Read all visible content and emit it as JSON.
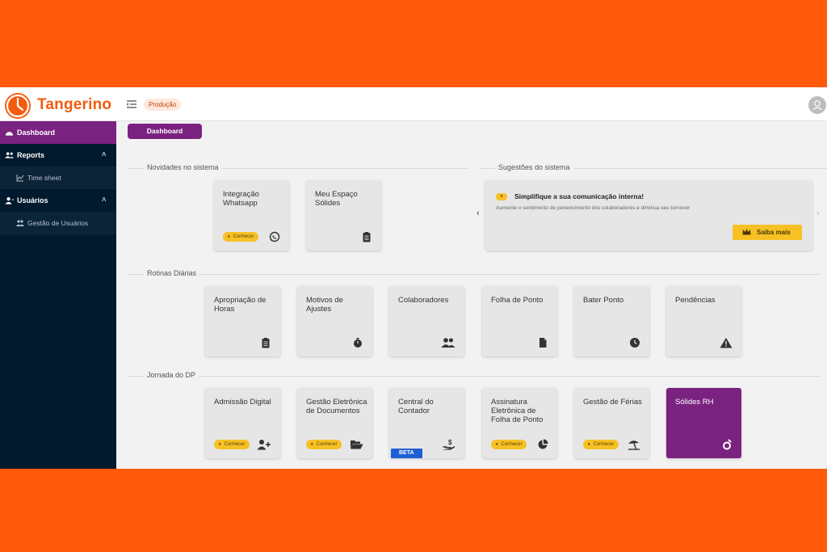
{
  "app": {
    "brand": "Tangerino",
    "environment": "Produção",
    "accent_color": "#7a2280",
    "brand_color": "#f35b0d"
  },
  "sidebar": {
    "items": [
      {
        "label": "Dashboard",
        "icon": "dashboard-icon",
        "active": true
      },
      {
        "label": "Reports",
        "icon": "users-icon",
        "expanded": true,
        "chevron": "˄"
      },
      {
        "label": "Time sheet",
        "icon": "chart-icon",
        "sub": true
      },
      {
        "label": "Usuários",
        "icon": "user-icon",
        "expanded": true,
        "chevron": "˄"
      },
      {
        "label": "Gestão de Usuários",
        "icon": "users-cog-icon",
        "sub": true
      }
    ]
  },
  "main": {
    "dashboard_button": "Dashboard",
    "sections": {
      "novidades": "Novidades no sistema",
      "sugestoes": "Sugestões do sistema",
      "rotinas": "Rotinas Diárias",
      "jornada": "Jornada do DP"
    },
    "novidades_cards": [
      {
        "title": "Integração Whatsapp",
        "chip": "Conhecer",
        "icon": "whatsapp-icon"
      },
      {
        "title": "Meu Espaço Sólides",
        "icon": "clipboard-icon"
      }
    ],
    "suggestion": {
      "badge": "★",
      "title": "Simplifique a sua comunicação interna!",
      "description": "Aumente o sentimento de pertencimento dos colaboradores e diminua seu turnover",
      "button": "Saiba mais",
      "prev": "‹",
      "next": "›"
    },
    "rotinas_cards": [
      {
        "title": "Apropriação de Horas",
        "icon": "clipboard-icon"
      },
      {
        "title": "Motivos de Ajustes",
        "icon": "stopwatch-icon"
      },
      {
        "title": "Colaboradores",
        "icon": "users-icon"
      },
      {
        "title": "Folha de Ponto",
        "icon": "file-icon"
      },
      {
        "title": "Bater Ponto",
        "icon": "clock-icon"
      },
      {
        "title": "Pendências",
        "icon": "warning-icon"
      }
    ],
    "jornada_cards": [
      {
        "title": "Admissão Digital",
        "chip": "Conhecer",
        "icon": "user-plus-icon"
      },
      {
        "title": "Gestão Eletrônica de Documentos",
        "chip": "Conhecer",
        "icon": "folder-open-icon"
      },
      {
        "title": "Central do Contador",
        "badge": "BETA",
        "icon": "hand-dollar-icon"
      },
      {
        "title": "Assinatura Eletrônica de Folha de Ponto",
        "chip": "Conhecer",
        "icon": "pie-chart-icon"
      },
      {
        "title": "Gestão de Férias",
        "chip": "Conhecer",
        "icon": "beach-umbrella-icon"
      },
      {
        "title": "Sólides RH",
        "icon": "solides-logo-icon"
      }
    ]
  }
}
